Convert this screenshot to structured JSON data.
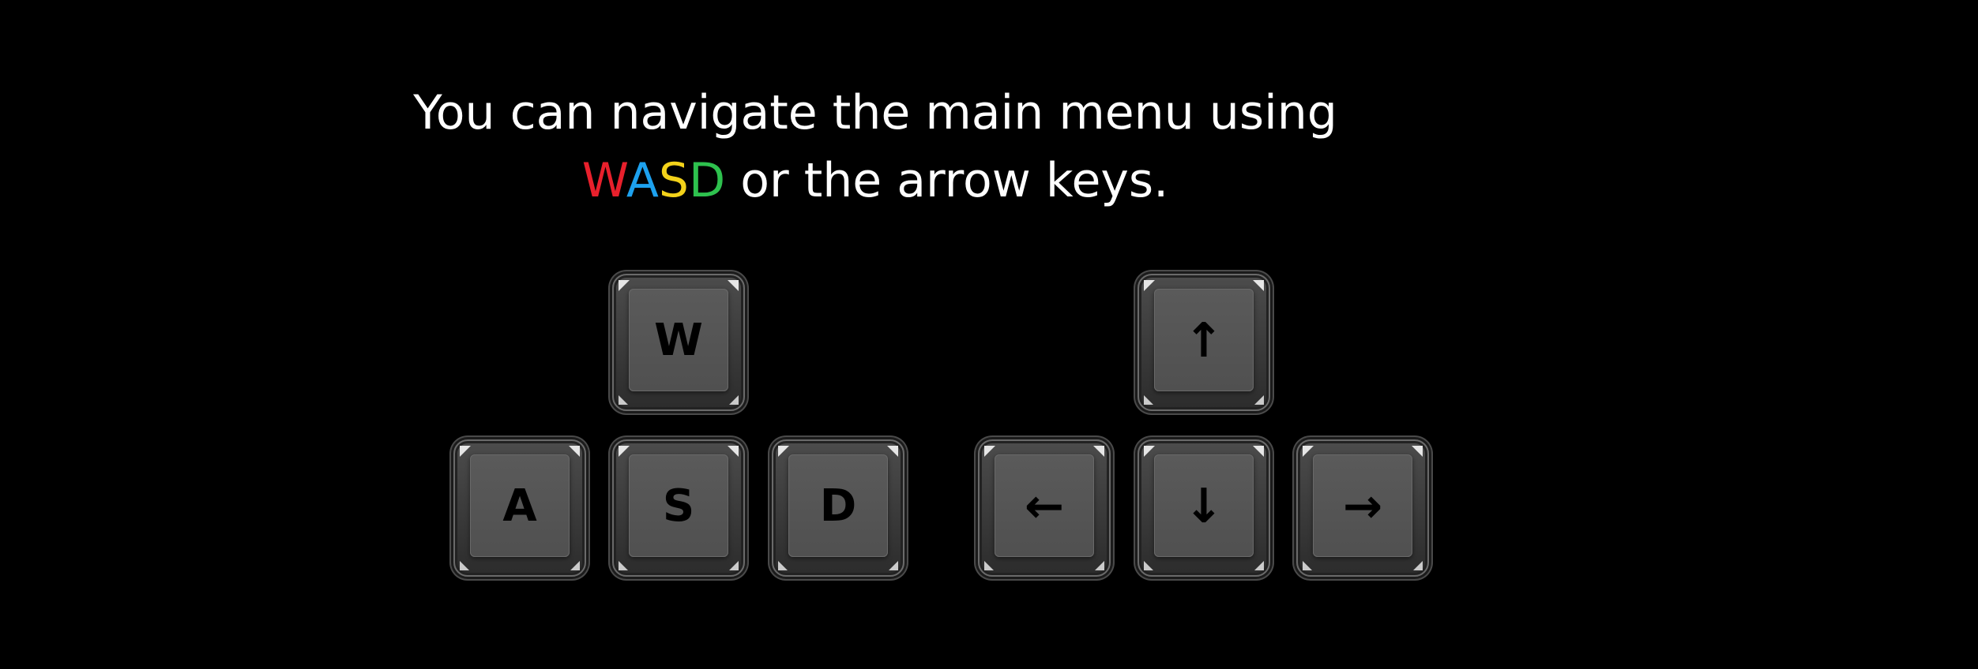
{
  "instructions": {
    "line1": "You can navigate the main menu using",
    "line2_w": "W",
    "line2_a": "A",
    "line2_s": "S",
    "line2_d": "D",
    "line2_rest": " or the arrow keys."
  },
  "colors": {
    "background": "#000000",
    "text": "#ffffff",
    "w_letter": "#e8202c",
    "a_letter": "#1da1ee",
    "s_letter": "#f3d21a",
    "d_letter": "#2ec14e",
    "key_face": "#505050",
    "key_legend": "#000000"
  },
  "wasd_keys": {
    "w": "W",
    "a": "A",
    "s": "S",
    "d": "D"
  },
  "arrow_keys": {
    "up": "↑",
    "left": "←",
    "down": "↓",
    "right": "→"
  },
  "icons": {
    "up": "arrow-up-icon",
    "left": "arrow-left-icon",
    "down": "arrow-down-icon",
    "right": "arrow-right-icon"
  }
}
